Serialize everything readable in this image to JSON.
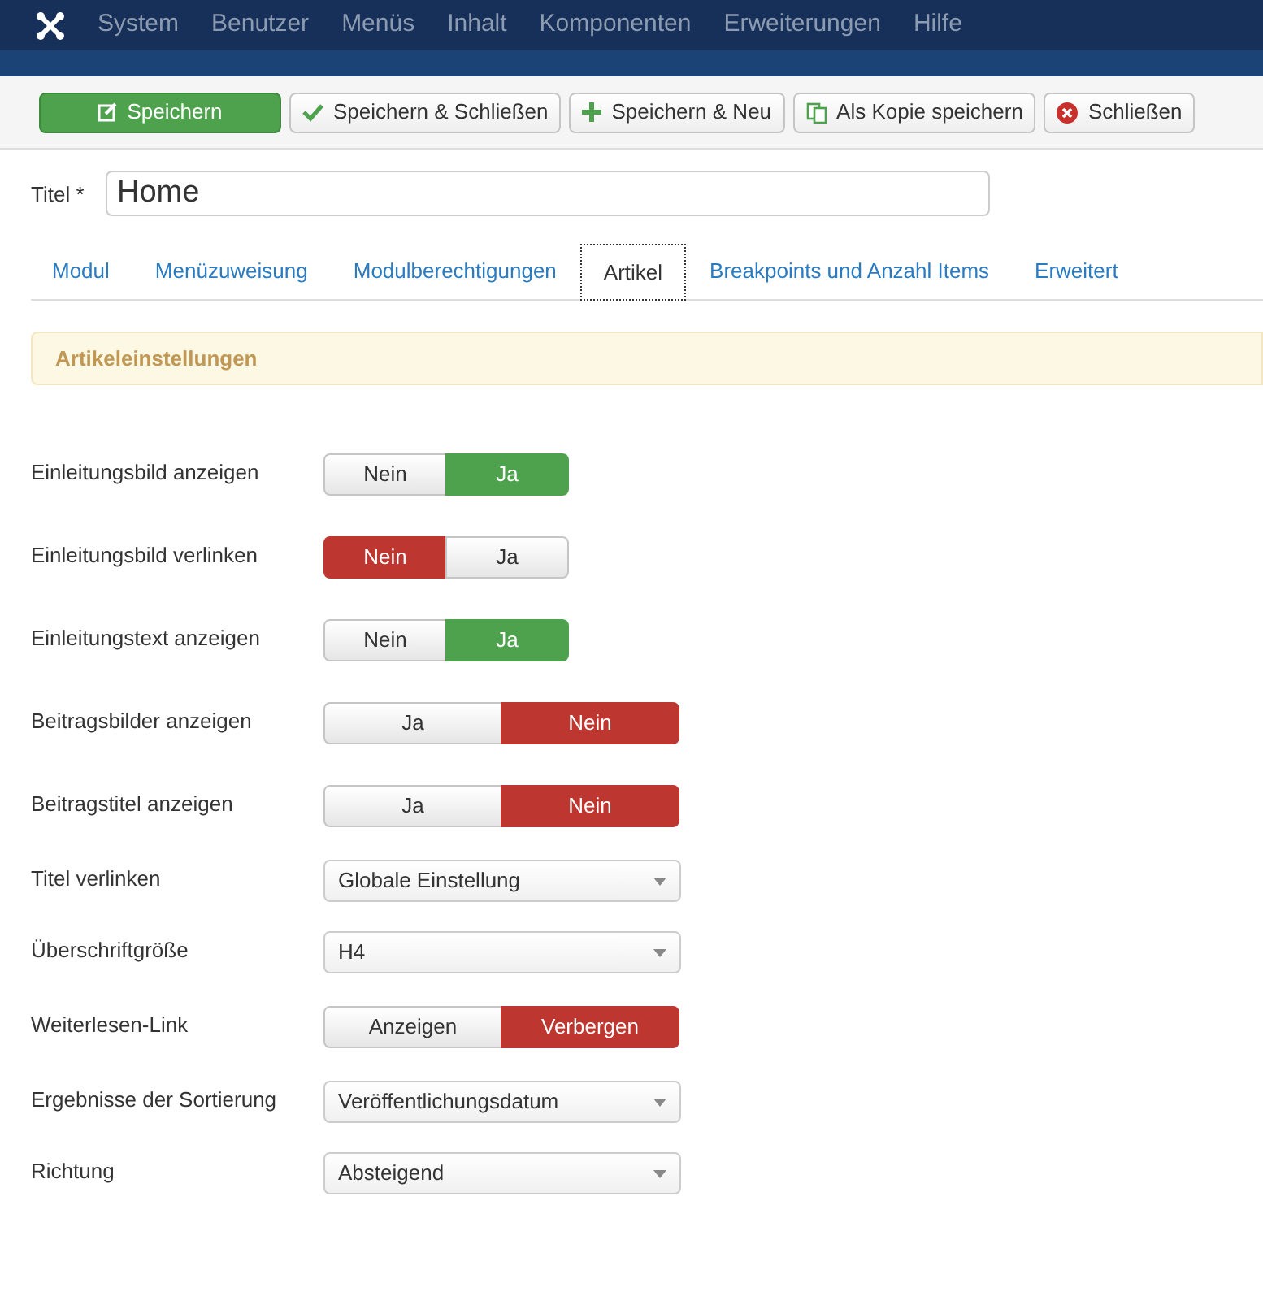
{
  "menu_bar": {
    "items": [
      "System",
      "Benutzer",
      "Menüs",
      "Inhalt",
      "Komponenten",
      "Erweiterungen",
      "Hilfe"
    ]
  },
  "toolbar": {
    "buttons": [
      {
        "label": "Speichern",
        "kind": "primary"
      },
      {
        "label": "Speichern & Schließen",
        "kind": "check"
      },
      {
        "label": "Speichern & Neu",
        "kind": "plus"
      },
      {
        "label": "Als Kopie speichern",
        "kind": "copy"
      },
      {
        "label": "Schließen",
        "kind": "close"
      }
    ]
  },
  "title_field": {
    "label": "Titel *",
    "value": "Home"
  },
  "tabs": [
    {
      "label": "Modul",
      "selected": false
    },
    {
      "label": "Menüzuweisung",
      "selected": false
    },
    {
      "label": "Modulberechtigungen",
      "selected": false
    },
    {
      "label": "Artikel",
      "selected": true
    },
    {
      "label": "Breakpoints und Anzahl Items",
      "selected": false
    },
    {
      "label": "Erweitert",
      "selected": false
    }
  ],
  "section_heading": "Artikeleinstellungen",
  "fields": [
    {
      "label": "Einleitungsbild anzeigen",
      "kind": "toggle",
      "color": "#4ea24e",
      "options": [
        {
          "label": "Nein",
          "selected": false
        },
        {
          "label": "Ja",
          "selected": true
        }
      ]
    },
    {
      "label": "Einleitungsbild verlinken",
      "kind": "toggle",
      "color": "#bd362f",
      "options": [
        {
          "label": "Nein",
          "selected": true
        },
        {
          "label": "Ja",
          "selected": false
        }
      ]
    },
    {
      "label": "Einleitungstext anzeigen",
      "kind": "toggle",
      "color": "#4ea24e",
      "options": [
        {
          "label": "Nein",
          "selected": false
        },
        {
          "label": "Ja",
          "selected": true
        }
      ]
    },
    {
      "label": "Beitragsbilder anzeigen",
      "kind": "toggle-wide",
      "color": "#bd362f",
      "options": [
        {
          "label": "Ja",
          "selected": false
        },
        {
          "label": "Nein",
          "selected": true
        }
      ]
    },
    {
      "label": "Beitragstitel anzeigen",
      "kind": "toggle-wide",
      "color": "#bd362f",
      "options": [
        {
          "label": "Ja",
          "selected": false
        },
        {
          "label": "Nein",
          "selected": true
        }
      ]
    },
    {
      "label": "Titel verlinken",
      "kind": "select",
      "value": "Globale Einstellung"
    },
    {
      "label": "Überschriftgröße",
      "kind": "select",
      "value": "H4"
    },
    {
      "label": "Weiterlesen-Link",
      "kind": "toggle-wide",
      "color": "#bd362f",
      "options": [
        {
          "label": "Anzeigen",
          "selected": false
        },
        {
          "label": "Verbergen",
          "selected": true
        }
      ]
    },
    {
      "label": "Ergebnisse der Sortierung",
      "kind": "select",
      "value": "Veröffentlichungsdatum"
    },
    {
      "label": "Richtung",
      "kind": "select",
      "value": "Absteigend"
    }
  ]
}
